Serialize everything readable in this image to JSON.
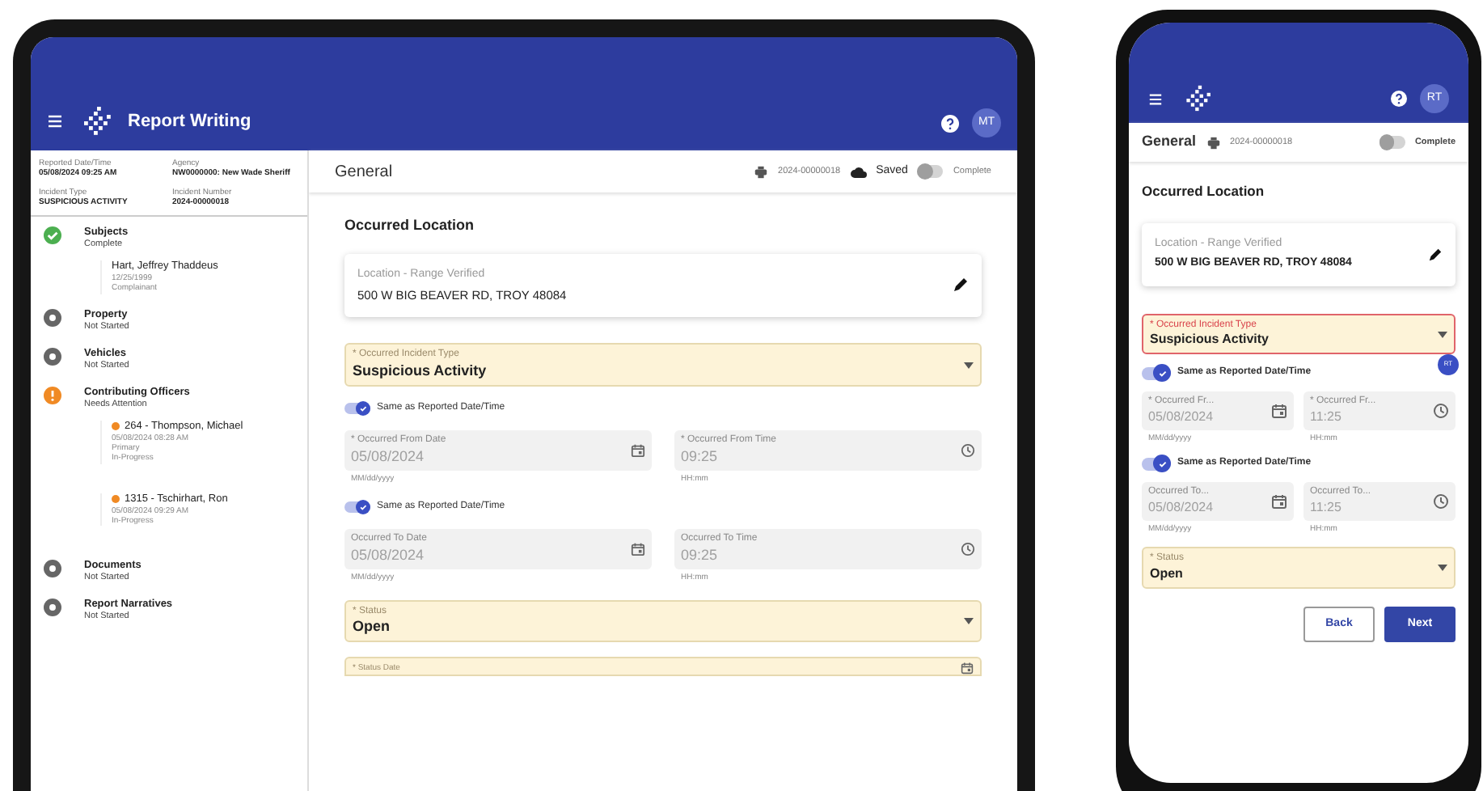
{
  "tablet": {
    "header": {
      "title": "Report Writing",
      "avatar": "MT"
    },
    "info": [
      {
        "label": "Reported Date/Time",
        "value": "05/08/2024 09:25 AM"
      },
      {
        "label": "Agency",
        "value": "NW0000000: New Wade Sheriff"
      },
      {
        "label": "Incident Type",
        "value": "SUSPICIOUS ACTIVITY"
      },
      {
        "label": "Incident Number",
        "value": "2024-00000018"
      }
    ],
    "nav": [
      {
        "title": "Subjects",
        "status": "Complete",
        "kind": "complete",
        "children": [
          {
            "title": "Hart, Jeffrey Thaddeus",
            "lines": [
              "12/25/1999",
              "Complainant"
            ],
            "flag": false
          }
        ]
      },
      {
        "title": "Property",
        "status": "Not Started",
        "kind": "not_started"
      },
      {
        "title": "Vehicles",
        "status": "Not Started",
        "kind": "not_started"
      },
      {
        "title": "Contributing Officers",
        "status": "Needs Attention",
        "kind": "attention",
        "children": [
          {
            "title": "264 - Thompson, Michael",
            "lines": [
              "05/08/2024 08:28 AM",
              "Primary",
              "In-Progress"
            ],
            "flag": true
          },
          {
            "title": "1315 - Tschirhart, Ron",
            "lines": [
              "05/08/2024 09:29 AM",
              "In-Progress"
            ],
            "flag": true
          }
        ]
      },
      {
        "title": "Documents",
        "status": "Not Started",
        "kind": "not_started"
      },
      {
        "title": "Report Narratives",
        "status": "Not Started",
        "kind": "not_started"
      }
    ],
    "toolbar": {
      "title": "General",
      "record": "2024-00000018",
      "saved": "Saved",
      "complete": {
        "label": "Complete",
        "on": false
      }
    },
    "heading": "Occurred Location",
    "location": {
      "label": "Location - Range Verified",
      "value": "500 W BIG BEAVER RD, TROY 48084"
    },
    "rows": [
      {
        "kind": "select",
        "label": "* Occurred Incident Type",
        "value": "Suspicious Activity",
        "error": false
      },
      {
        "kind": "toggle",
        "label": "Same as Reported Date/Time",
        "on": true
      },
      {
        "kind": "pair",
        "fields": [
          {
            "kind": "date",
            "label": "* Occurred From Date",
            "value": "05/08/2024",
            "hint": "MM/dd/yyyy",
            "disabled": true
          },
          {
            "kind": "time",
            "label": "* Occurred From Time",
            "value": "09:25",
            "hint": "HH:mm",
            "disabled": true
          }
        ]
      },
      {
        "kind": "toggle",
        "label": "Same as Reported Date/Time",
        "on": true
      },
      {
        "kind": "pair",
        "fields": [
          {
            "kind": "date",
            "label": "Occurred To Date",
            "value": "05/08/2024",
            "hint": "MM/dd/yyyy",
            "disabled": true
          },
          {
            "kind": "time",
            "label": "Occurred To Time",
            "value": "09:25",
            "hint": "HH:mm",
            "disabled": true
          }
        ]
      },
      {
        "kind": "select",
        "label": "* Status",
        "value": "Open",
        "error": false
      },
      {
        "kind": "datefield",
        "label": "* Status Date"
      }
    ]
  },
  "phone": {
    "header": {
      "avatar": "RT"
    },
    "toolbar": {
      "title": "General",
      "record": "2024-00000018",
      "complete": {
        "label": "Complete",
        "on": false
      }
    },
    "heading": "Occurred Location",
    "location": {
      "label": "Location - Range Verified",
      "value": "500 W BIG BEAVER RD, TROY 48084"
    },
    "badge": "RT",
    "rows": [
      {
        "kind": "select",
        "label": "* Occurred Incident Type",
        "value": "Suspicious Activity",
        "error": true
      },
      {
        "kind": "toggle",
        "label": "Same as Reported Date/Time",
        "on": true
      },
      {
        "kind": "pair",
        "fields": [
          {
            "kind": "date",
            "label": "* Occurred Fr...",
            "value": "05/08/2024",
            "hint": "MM/dd/yyyy",
            "disabled": true
          },
          {
            "kind": "time",
            "label": "* Occurred Fr...",
            "value": "11:25",
            "hint": "HH:mm",
            "disabled": true
          }
        ]
      },
      {
        "kind": "toggle",
        "label": "Same as Reported Date/Time",
        "on": true
      },
      {
        "kind": "pair",
        "fields": [
          {
            "kind": "date",
            "label": "Occurred To...",
            "value": "05/08/2024",
            "hint": "MM/dd/yyyy",
            "disabled": true
          },
          {
            "kind": "time",
            "label": "Occurred To...",
            "value": "11:25",
            "hint": "HH:mm",
            "disabled": true
          }
        ]
      },
      {
        "kind": "select",
        "label": "* Status",
        "value": "Open",
        "error": false
      }
    ],
    "buttons": [
      {
        "label": "Back",
        "kind": "secondary"
      },
      {
        "label": "Next",
        "kind": "primary"
      }
    ]
  }
}
